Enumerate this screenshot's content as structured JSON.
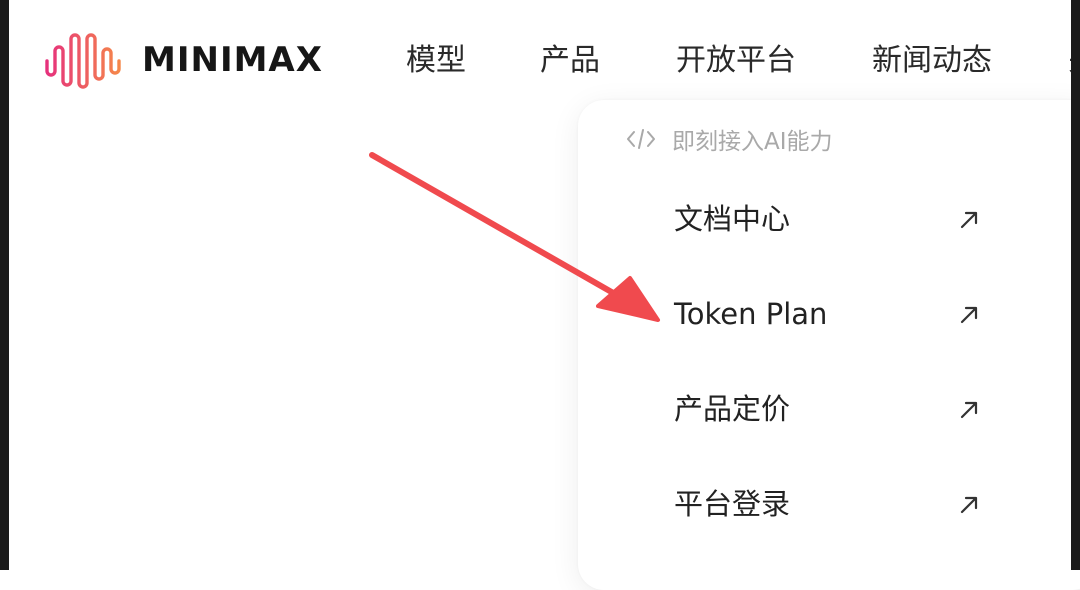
{
  "brand": {
    "name": "MINIMAX",
    "logo_icon": "waveform-logo-icon",
    "gradient": [
      "#e6317c",
      "#f5874a"
    ]
  },
  "nav": {
    "items": [
      "模型",
      "产品",
      "开放平台",
      "新闻动态",
      "关"
    ]
  },
  "dropdown": {
    "header_icon": "code-brackets-icon",
    "header_label": "即刻接入AI能力",
    "items": [
      {
        "label": "文档中心",
        "icon": "external-link-arrow-icon"
      },
      {
        "label": "Token Plan",
        "icon": "external-link-arrow-icon"
      },
      {
        "label": "产品定价",
        "icon": "external-link-arrow-icon"
      },
      {
        "label": "平台登录",
        "icon": "external-link-arrow-icon"
      }
    ]
  },
  "annotation": {
    "type": "arrow",
    "color": "#f04a4e",
    "points_to": "Token Plan"
  },
  "colors": {
    "text": "#1e1e1e",
    "muted": "#a9a9a9",
    "background": "#ffffff"
  }
}
